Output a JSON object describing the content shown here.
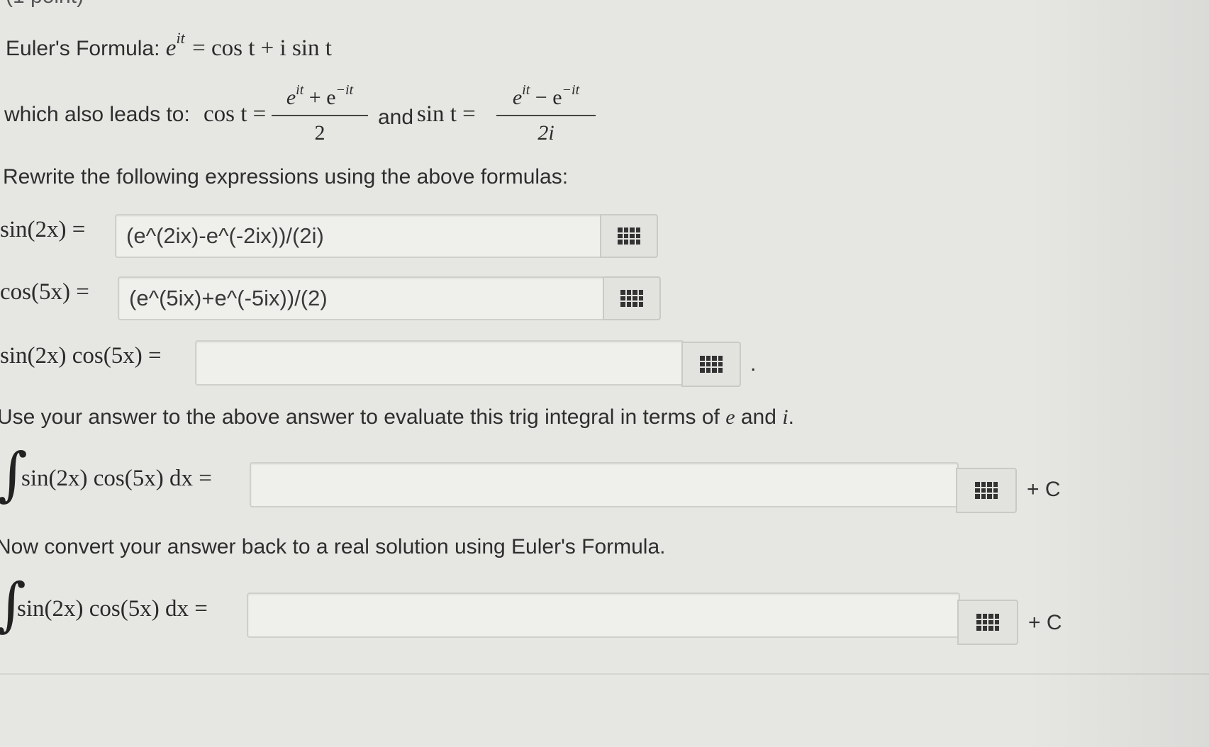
{
  "header": {
    "points_label": "(1 point)"
  },
  "euler": {
    "prefix": "Euler's Formula: ",
    "lhs_base": "e",
    "lhs_exp": "it",
    "rhs": "= cos t + i sin t"
  },
  "derived": {
    "prefix": "which also leads to: ",
    "cos_lhs": "cos t =",
    "cos_num": "e",
    "cos_num_exp1": "it",
    "cos_num_mid": " + e",
    "cos_num_exp2": "−it",
    "cos_den": "2",
    "and_text": "and ",
    "sin_lhs": "sin t =",
    "sin_num": "e",
    "sin_num_exp1": "it",
    "sin_num_mid": " − e",
    "sin_num_exp2": "−it",
    "sin_den": "2i"
  },
  "instructions": {
    "rewrite": "Rewrite the following expressions using the above formulas:",
    "use_answer_prefix": "Use your answer to the above answer to evaluate this trig integral in terms of ",
    "use_answer_e": "e",
    "use_answer_and": " and ",
    "use_answer_i": "i",
    "use_answer_suffix": ".",
    "convert": "Now convert your answer back to a real solution using Euler's Formula."
  },
  "questions": [
    {
      "label": "sin(2x) =",
      "value": "(e^(2ix)-e^(-2ix))/(2i)",
      "suffix": ""
    },
    {
      "label": "cos(5x) =",
      "value": "(e^(5ix)+e^(-5ix))/(2)",
      "suffix": ""
    },
    {
      "label": "sin(2x) cos(5x) =",
      "value": "",
      "suffix": "."
    },
    {
      "label": "sin(2x) cos(5x) dx =",
      "value": "",
      "suffix": "+ C",
      "integral_sign": "∫"
    },
    {
      "label": "sin(2x) cos(5x) dx =",
      "value": "",
      "suffix": "+ C",
      "integral_sign": "∫"
    }
  ],
  "icons": {
    "equation_editor": "grid-icon"
  }
}
